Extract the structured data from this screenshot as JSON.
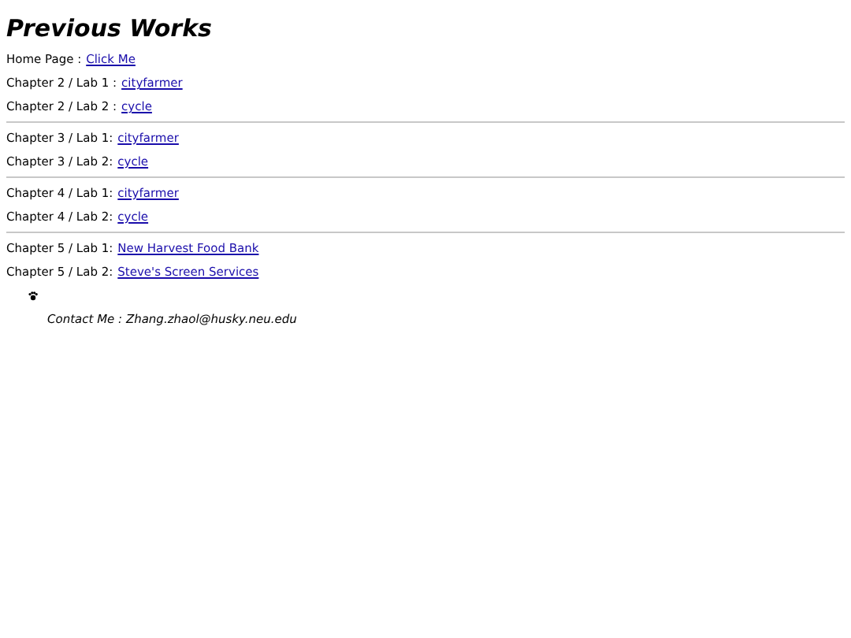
{
  "title": "Previous Works",
  "groups": [
    {
      "rows": [
        {
          "label": "Home Page :",
          "link": "Click Me"
        },
        {
          "label": "Chapter 2 / Lab 1 :",
          "link": "cityfarmer"
        },
        {
          "label": "Chapter 2 / Lab 2 :",
          "link": "cycle"
        }
      ]
    },
    {
      "rows": [
        {
          "label": "Chapter 3 / Lab 1:",
          "link": "cityfarmer"
        },
        {
          "label": "Chapter 3 / Lab 2:",
          "link": "cycle"
        }
      ]
    },
    {
      "rows": [
        {
          "label": "Chapter 4 / Lab 1:",
          "link": "cityfarmer"
        },
        {
          "label": "Chapter 4 / Lab 2:",
          "link": "cycle"
        }
      ]
    },
    {
      "rows": [
        {
          "label": "Chapter 5 / Lab 1:",
          "link": "New Harvest Food Bank"
        },
        {
          "label": "Chapter 5 / Lab 2:",
          "link": "Steve's Screen Services"
        }
      ]
    }
  ],
  "contact": "Contact Me : Zhang.zhaol@husky.neu.edu"
}
